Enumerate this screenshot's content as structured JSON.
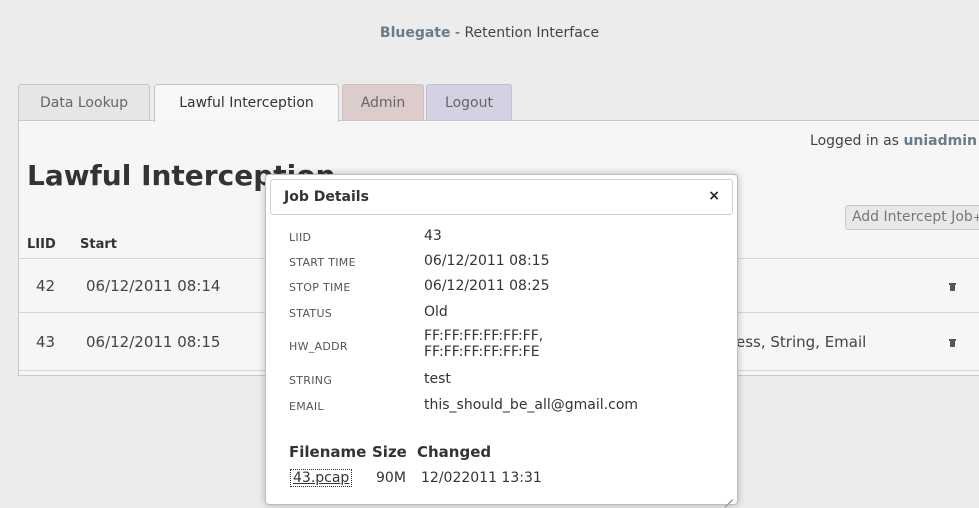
{
  "header": {
    "brand": "Bluegate",
    "title_rest": " - Retention Interface"
  },
  "tabs": [
    {
      "label": "Data Lookup"
    },
    {
      "label": "Lawful Interception"
    },
    {
      "label": "Admin"
    },
    {
      "label": "Logout"
    }
  ],
  "user": {
    "prefix": "Logged in as ",
    "name": "uniadmin"
  },
  "page": {
    "title": "Lawful Interception",
    "add_button": "Add Intercept Job",
    "add_plus": "+"
  },
  "table": {
    "headers": {
      "liid": "LIID",
      "start": "Start"
    },
    "rows": [
      {
        "liid": "42",
        "start": "06/12/2011 08:14",
        "type": ""
      },
      {
        "liid": "43",
        "start": "06/12/2011 08:15",
        "type": "ess, String, Email"
      }
    ]
  },
  "modal": {
    "title": "Job Details",
    "close": "×",
    "details": [
      {
        "label": "LIID",
        "value": "43"
      },
      {
        "label": "START TIME",
        "value": "06/12/2011 08:15"
      },
      {
        "label": "STOP TIME",
        "value": "06/12/2011 08:25"
      },
      {
        "label": "STATUS",
        "value": "Old"
      },
      {
        "label": "HW_ADDR",
        "value1": "FF:FF:FF:FF:FF:FF,",
        "value2": "FF:FF:FF:FF:FF:FE"
      },
      {
        "label": "STRING",
        "value": "test"
      },
      {
        "label": "EMAIL",
        "value": "this_should_be_all@gmail.com"
      }
    ],
    "files": {
      "headers": {
        "filename": "Filename",
        "size": "Size",
        "changed": "Changed"
      },
      "rows": [
        {
          "filename": "43.pcap",
          "size": "90M",
          "changed": "12/022011 13:31"
        }
      ]
    }
  }
}
